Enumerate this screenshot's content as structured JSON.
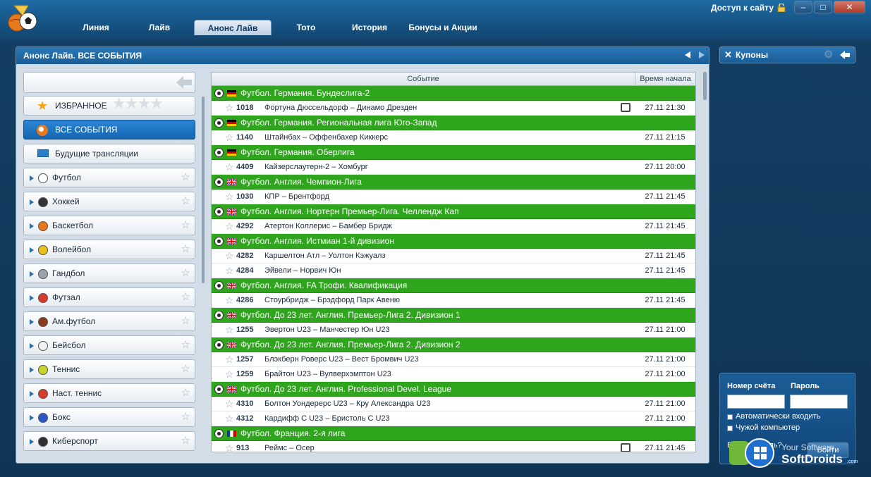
{
  "window": {
    "access_label": "Доступ к сайту",
    "minimize": "–",
    "restore": "□",
    "close": "✕"
  },
  "tabs": [
    {
      "label": "Линия",
      "active": false
    },
    {
      "label": "Лайв",
      "active": false
    },
    {
      "label": "Анонс Лайв",
      "active": true
    },
    {
      "label": "Тото",
      "active": false
    },
    {
      "label": "История",
      "active": false
    },
    {
      "label": "Бонусы и Акции",
      "active": false
    }
  ],
  "main": {
    "title": "Анонс Лайв. ВСЕ СОБЫТИЯ"
  },
  "sidebar": {
    "favorites": "ИЗБРАННОЕ",
    "all_events": "ВСЕ СОБЫТИЯ",
    "future_broadcasts": "Будущие трансляции",
    "sports": [
      {
        "label": "Футбол",
        "color": "#ffffff",
        "icon": "football-icon"
      },
      {
        "label": "Хоккей",
        "color": "#333333",
        "icon": "hockey-icon"
      },
      {
        "label": "Баскетбол",
        "color": "#e8791a",
        "icon": "basketball-icon"
      },
      {
        "label": "Волейбол",
        "color": "#e8c21a",
        "icon": "volleyball-icon"
      },
      {
        "label": "Гандбол",
        "color": "#9aa3ab",
        "icon": "handball-icon"
      },
      {
        "label": "Футзал",
        "color": "#d83a2a",
        "icon": "futsal-icon"
      },
      {
        "label": "Ам.футбол",
        "color": "#8b3a1a",
        "icon": "american-football-icon"
      },
      {
        "label": "Бейсбол",
        "color": "#f2f2f2",
        "icon": "baseball-icon"
      },
      {
        "label": "Теннис",
        "color": "#c8d62a",
        "icon": "tennis-icon"
      },
      {
        "label": "Наст. теннис",
        "color": "#d83a2a",
        "icon": "table-tennis-icon"
      },
      {
        "label": "Бокс",
        "color": "#2a56c8",
        "icon": "boxing-icon"
      },
      {
        "label": "Киберспорт",
        "color": "#2f2f2f",
        "icon": "esports-icon"
      }
    ]
  },
  "table": {
    "col_event": "Событие",
    "col_time": "Время начала",
    "items": [
      {
        "type": "group",
        "name": "Футбол. Германия. Бундеслига-2",
        "flag": "de"
      },
      {
        "type": "event",
        "num": "1018",
        "name": "Фортуна Дюссельдорф – Динамо Дрезден",
        "time": "27.11 21:30",
        "tv": true
      },
      {
        "type": "group",
        "name": "Футбол. Германия. Региональная лига Юго-Запад",
        "flag": "de"
      },
      {
        "type": "event",
        "num": "1140",
        "name": "Штайнбах – Оффенбахер Киккерс",
        "time": "27.11 21:15",
        "tv": false
      },
      {
        "type": "group",
        "name": "Футбол. Германия. Оберлига",
        "flag": "de"
      },
      {
        "type": "event",
        "num": "4409",
        "name": "Кайзерслаутерн-2 – Хомбург",
        "time": "27.11 20:00",
        "tv": false
      },
      {
        "type": "group",
        "name": "Футбол. Англия. Чемпион-Лига",
        "flag": "uk"
      },
      {
        "type": "event",
        "num": "1030",
        "name": "КПР – Брентфорд",
        "time": "27.11 21:45",
        "tv": false
      },
      {
        "type": "group",
        "name": "Футбол. Англия. Нортерн Премьер-Лига. Челлендж Кап",
        "flag": "uk"
      },
      {
        "type": "event",
        "num": "4292",
        "name": "Атертон Коллерис – Бамбер Бридж",
        "time": "27.11 21:45",
        "tv": false
      },
      {
        "type": "group",
        "name": "Футбол. Англия. Истмиан 1-й дивизион",
        "flag": "uk"
      },
      {
        "type": "event",
        "num": "4282",
        "name": "Каршелтон Атл – Уолтон Кэжуалз",
        "time": "27.11 21:45",
        "tv": false
      },
      {
        "type": "event",
        "num": "4284",
        "name": "Эйвели – Норвич Юн",
        "time": "27.11 21:45",
        "tv": false
      },
      {
        "type": "group",
        "name": "Футбол. Англия. FA Трофи. Квалификация",
        "flag": "uk"
      },
      {
        "type": "event",
        "num": "4286",
        "name": "Стоурбридж – Брэдфорд Парк Авеню",
        "time": "27.11 21:45",
        "tv": false
      },
      {
        "type": "group",
        "name": "Футбол. До 23 лет. Англия. Премьер-Лига 2. Дивизион 1",
        "flag": "uk"
      },
      {
        "type": "event",
        "num": "1255",
        "name": "Эвертон U23 – Манчестер Юн U23",
        "time": "27.11 21:00",
        "tv": false
      },
      {
        "type": "group",
        "name": "Футбол. До 23 лет. Англия. Премьер-Лига 2. Дивизион 2",
        "flag": "uk"
      },
      {
        "type": "event",
        "num": "1257",
        "name": "Блэкберн Роверс U23 – Вест Бромвич U23",
        "time": "27.11 21:00",
        "tv": false
      },
      {
        "type": "event",
        "num": "1259",
        "name": "Брайтон U23 – Вулверхэмптон U23",
        "time": "27.11 21:00",
        "tv": false
      },
      {
        "type": "group",
        "name": "Футбол. До 23 лет. Англия. Professional Devel. League",
        "flag": "uk"
      },
      {
        "type": "event",
        "num": "4310",
        "name": "Болтон Уондерерс U23 – Кру Александра U23",
        "time": "27.11 21:00",
        "tv": false
      },
      {
        "type": "event",
        "num": "4312",
        "name": "Кардифф С U23 – Бристоль С U23",
        "time": "27.11 21:00",
        "tv": false
      },
      {
        "type": "group",
        "name": "Футбол. Франция. 2-я лига",
        "flag": "fr"
      },
      {
        "type": "event",
        "num": "913",
        "name": "Реймс – Осер",
        "time": "27.11 21:45",
        "tv": true
      }
    ]
  },
  "coupons": {
    "title": "Купоны"
  },
  "login": {
    "account_label": "Номер счёта",
    "password_label": "Пароль",
    "account_value": "",
    "password_value": "",
    "auto_login": "Автоматически входить",
    "foreign_pc": "Чужой компьютер",
    "remember_prefix": "В",
    "remember_suffix": "ль?",
    "login_button": "Войти"
  },
  "watermark": {
    "line1": "Your Software",
    "line2": "SoftDroids",
    "line3": ".com"
  }
}
